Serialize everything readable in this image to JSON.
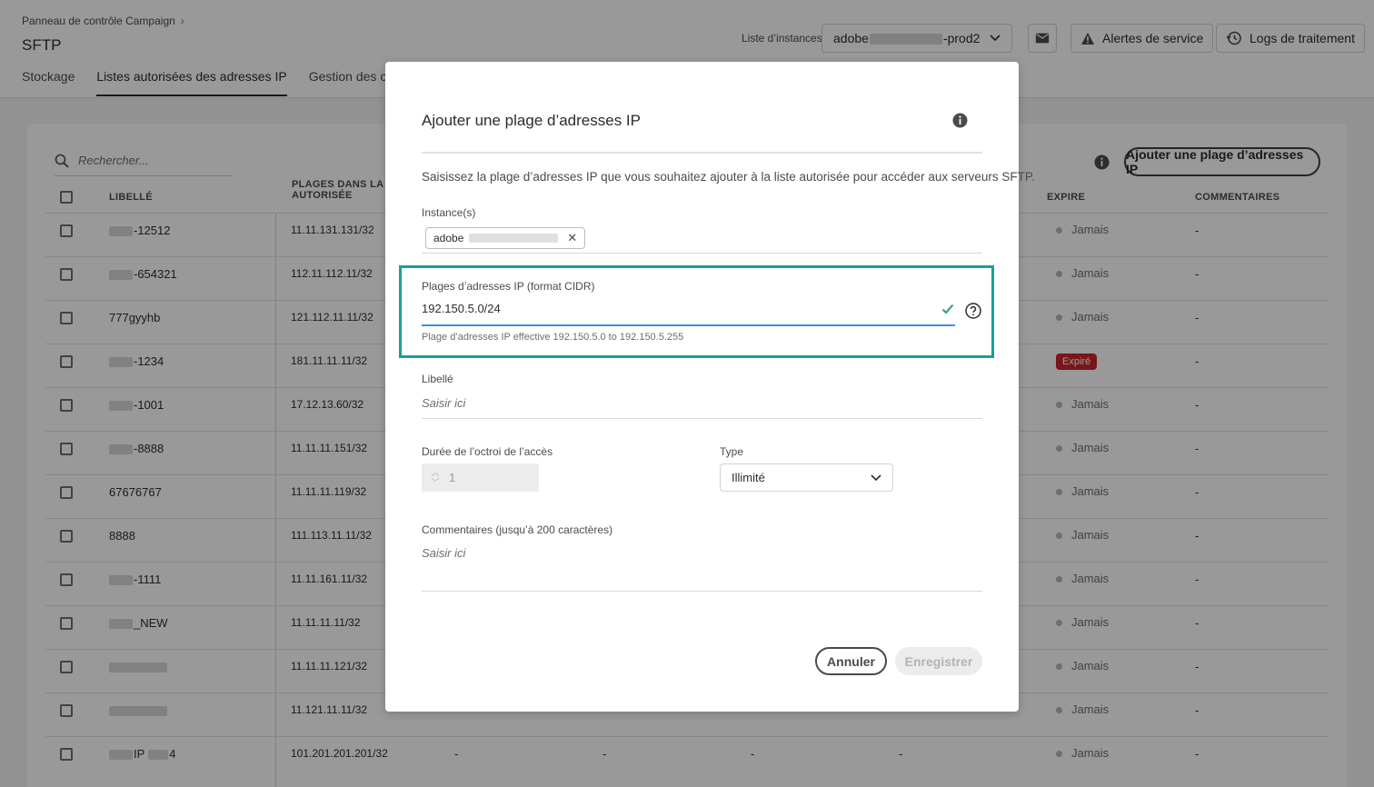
{
  "header": {
    "breadcrumb": "Panneau de contrôle Campaign",
    "title": "SFTP",
    "tabs": [
      "Stockage",
      "Listes autorisées des adresses IP",
      "Gestion des clés"
    ],
    "instance_label": "Liste d’instances",
    "instance_prefix": "adobe",
    "instance_suffix": "-prod2",
    "service_alerts": "Alertes de service",
    "processing_logs": "Logs de traitement"
  },
  "list": {
    "search_placeholder": "Rechercher...",
    "add_button": "Ajouter une plage d’adresses IP",
    "columns": {
      "label": "LIBELLÉ",
      "ranges_line1": "PLAGES DANS LA LI",
      "ranges_line2": "AUTORISÉE",
      "expires": "EXPIRE",
      "comments": "COMMENTAIRES"
    },
    "rows": [
      {
        "label": "-12512",
        "ip": "11.11.131.131/32",
        "expires": "Jamais",
        "comment": "-"
      },
      {
        "label": "-654321",
        "ip": "112.11.112.11/32",
        "expires": "Jamais",
        "comment": "-"
      },
      {
        "label": "777gyyhb",
        "ip": "121.112.11.11/32",
        "expires": "Jamais",
        "comment": "-"
      },
      {
        "label": "-1234",
        "ip": "181.11.11.11/32",
        "expires": "Expiré",
        "comment": "-"
      },
      {
        "label": "-1001",
        "ip": "17.12.13.60/32",
        "expires": "Jamais",
        "comment": "-"
      },
      {
        "label": "-8888",
        "ip": "11.11.11.151/32",
        "expires": "Jamais",
        "comment": "-"
      },
      {
        "label": "67676767",
        "ip": "11.11.11.119/32",
        "expires": "Jamais",
        "comment": "-"
      },
      {
        "label": "8888",
        "ip": "111.113.11.11/32",
        "expires": "Jamais",
        "comment": "-"
      },
      {
        "label": "-1111",
        "ip": "11.11.161.11/32",
        "expires": "Jamais",
        "comment": "-"
      },
      {
        "label": "_NEW",
        "ip": "11.11.11.11/32",
        "expires": "Jamais",
        "comment": "-"
      },
      {
        "label": "",
        "ip": "11.11.11.121/32",
        "expires": "Jamais",
        "comment": "-"
      },
      {
        "label": "",
        "ip": "11.121.11.11/32",
        "expires": "Jamais",
        "comment": "-"
      },
      {
        "label": "IP",
        "label_suffix": "4",
        "ip": "101.201.201.201/32",
        "expires": "Jamais",
        "comment": "-"
      }
    ],
    "last_row_dashes": [
      "-",
      "-",
      "-",
      "-"
    ]
  },
  "modal": {
    "title": "Ajouter une plage d’adresses IP",
    "description": "Saisissez la plage d’adresses IP que vous souhaitez ajouter à la liste autorisée pour accéder aux serveurs SFTP.",
    "instances_label": "Instance(s)",
    "instance_tag_prefix": "adobe",
    "ip_label": "Plages d’adresses IP (format CIDR)",
    "ip_value": "192.150.5.0/24",
    "ip_hint": "Plage d’adresses IP effective 192.150.5.0 to 192.150.5.255",
    "libelle_label": "Libellé",
    "libelle_placeholder": "Saisir ici",
    "duration_label": "Durée de l’octroi de l’accès",
    "duration_value": "1",
    "type_label": "Type",
    "type_value": "Illimité",
    "comments_label": "Commentaires (jusqu’à 200 caractères)",
    "comments_placeholder": "Saisir ici",
    "cancel": "Annuler",
    "save": "Enregistrer"
  },
  "colors": {
    "highlight": "#18a096",
    "focus": "#378ef0",
    "valid": "#2d9d78",
    "expired": "#c9252d"
  }
}
